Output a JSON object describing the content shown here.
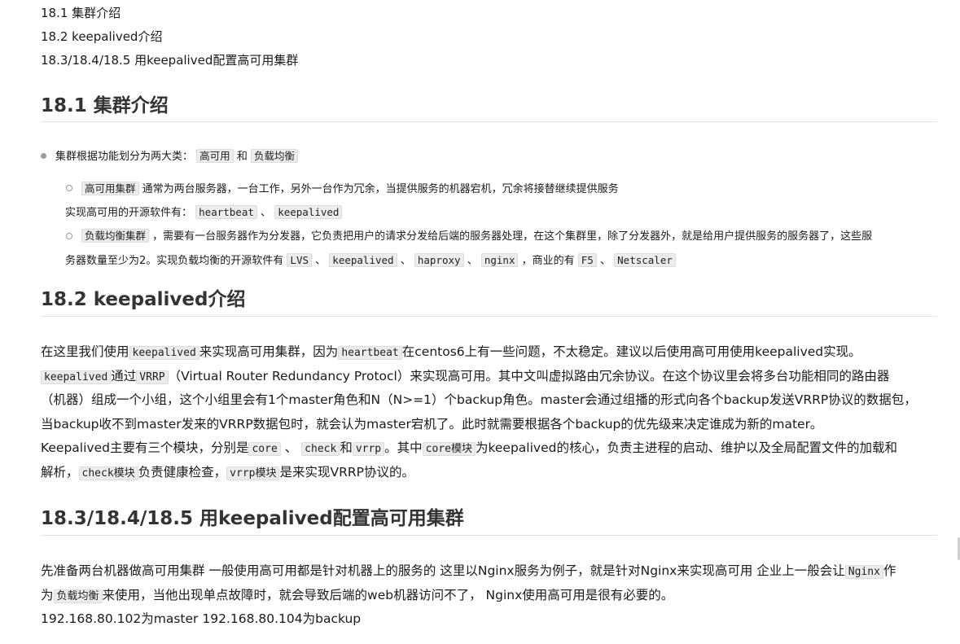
{
  "toc": [
    "18.1 集群介绍",
    "18.2 keepalived介绍",
    "18.3/18.4/18.5 用keepalived配置高可用集群"
  ],
  "section1": {
    "heading": "18.1 集群介绍",
    "bullet_prefix": "集群根据功能划分为两大类：",
    "code_ha": "高可用",
    "and": "和",
    "code_lb": "负载均衡",
    "sub1_code": "高可用集群",
    "sub1_text": "通常为两台服务器，一台工作，另外一台作为冗余，当提供服务的机器宕机，冗余将接替继续提供服务",
    "sub1_line2_prefix": "实现高可用的开源软件有：",
    "sub1_code2": "heartbeat",
    "sep": "、",
    "sub1_code3": "keepalived",
    "sub2_code": "负载均衡集群",
    "sub2_text": "，需要有一台服务器作为分发器，它负责把用户的请求分发给后端的服务器处理，在这个集群里，除了分发器外，就是给用户提供服务的服务器了，这些服",
    "sub2_line2_prefix": "务器数量至少为2。实现负载均衡的开源软件有",
    "code_lvs": "LVS",
    "code_keepalived": "keepalived",
    "code_haproxy": "haproxy",
    "code_nginx": "nginx",
    "commercial": "，商业的有",
    "code_f5": "F5",
    "code_netscaler": "Netscaler"
  },
  "section2": {
    "heading": "18.2 keepalived介绍",
    "p1_a": "在这里我们使用",
    "p1_code1": "keepalived",
    "p1_b": "来实现高可用集群，因为",
    "p1_code2": "heartbeat",
    "p1_c": "在centos6上有一些问题，不太稳定。建议以后使用高可用使用keepalived实现。",
    "p2_code1": "keepalived",
    "p2_a": "通过",
    "p2_code2": "VRRP",
    "p2_b": "（Virtual Router Redundancy Protocl）来实现高可用。其中文叫虚拟路由冗余协议。在这个协议里会将多台功能相同的路由器",
    "p3": "（机器）组成一个小组，这个小组里会有1个master角色和N（N>=1）个backup角色。master会通过组播的形式向各个backup发送VRRP协议的数据包，",
    "p4": "当backup收不到master发来的VRRP数据包时，就会认为master宕机了。此时就需要根据各个backup的优先级来决定谁成为新的mater。",
    "p5_a": "Keepalived主要有三个模块，分别是",
    "p5_code1": "core",
    "p5_code2": "check",
    "p5_and": "和",
    "p5_code3": "vrrp",
    "p5_b": "。其中",
    "p5_code4": "core模块",
    "p5_c": "为keepalived的核心，负责主进程的启动、维护以及全局配置文件的加载和",
    "p6_a": "解析，",
    "p6_code1": "check模块",
    "p6_b": "负责健康检查，",
    "p6_code2": "vrrp模块",
    "p6_c": "是来实现VRRP协议的。"
  },
  "section3": {
    "heading": "18.3/18.4/18.5 用keepalived配置高可用集群",
    "p1_a": "先准备两台机器做高可用集群 一般使用高可用都是针对机器上的服务的 这里以Nginx服务为例子，就是针对Nginx来实现高可用 企业上一般会让",
    "p1_code": "Nginx",
    "p1_b": "作",
    "p2_a": "为",
    "p2_code": "负载均衡",
    "p2_b": "来使用，当他出现单点故障时，就会导致后端的web机器访问不了， Nginx使用高可用是很有必要的。",
    "p3": "192.168.80.102为master 192.168.80.104为backup"
  }
}
